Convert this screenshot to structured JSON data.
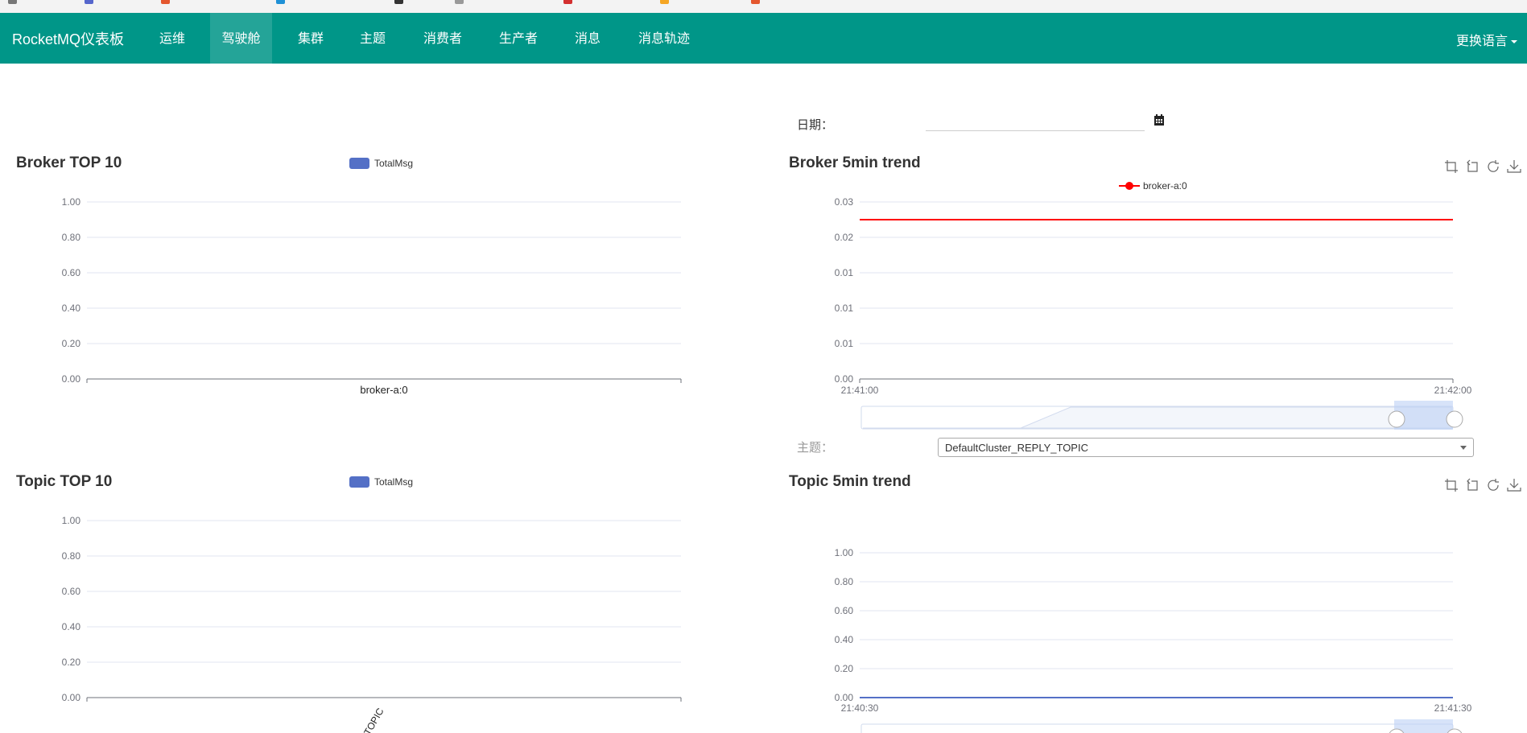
{
  "navbar": {
    "brand": "RocketMQ仪表板",
    "items": [
      {
        "label": "运维"
      },
      {
        "label": "驾驶舱"
      },
      {
        "label": "集群"
      },
      {
        "label": "主题"
      },
      {
        "label": "消费者"
      },
      {
        "label": "生产者"
      },
      {
        "label": "消息"
      },
      {
        "label": "消息轨迹"
      }
    ],
    "active_item": "驾驶舱",
    "language": "更换语言"
  },
  "date_filter": {
    "label": "日期：",
    "value": ""
  },
  "topic_filter": {
    "label": "主题：",
    "selected": "DefaultCluster_REPLY_TOPIC"
  },
  "colors": {
    "navbar": "#009688",
    "bar_series": "#5470c6",
    "broker_trend_line": "#ff0000",
    "topic_trend_line": "#5470c6"
  },
  "chart_data": [
    {
      "type": "bar",
      "title": "Broker TOP 10",
      "legend": [
        "TotalMsg"
      ],
      "categories": [
        "broker-a:0"
      ],
      "series": [
        {
          "name": "TotalMsg",
          "values": [
            0
          ]
        }
      ],
      "y_ticks": [
        "0.00",
        "0.20",
        "0.40",
        "0.60",
        "0.80",
        "1.00"
      ],
      "ylim": [
        0,
        1
      ],
      "grid": true
    },
    {
      "type": "line",
      "title": "Broker 5min trend",
      "legend": [
        "broker-a:0"
      ],
      "x_ticks": [
        "21:41:00",
        "21:42:00"
      ],
      "y_ticks": [
        "0.00",
        "0.01",
        "0.01",
        "0.01",
        "0.02",
        "0.03"
      ],
      "ylim": [
        0,
        0.025
      ],
      "series": [
        {
          "name": "broker-a:0",
          "x": [
            "21:41:00",
            "21:42:00"
          ],
          "values": [
            0.0225,
            0.0225
          ]
        }
      ],
      "grid": true,
      "has_data_zoom": true
    },
    {
      "type": "bar",
      "title": "Topic TOP 10",
      "legend": [
        "TotalMsg"
      ],
      "categories": [
        "DefaultCluster_REPLY_TOPIC"
      ],
      "category_label_visible": "_TOPIC",
      "series": [
        {
          "name": "TotalMsg",
          "values": [
            0
          ]
        }
      ],
      "y_ticks": [
        "0.00",
        "0.20",
        "0.40",
        "0.60",
        "0.80",
        "1.00"
      ],
      "ylim": [
        0,
        1
      ],
      "grid": true
    },
    {
      "type": "line",
      "title": "Topic 5min trend",
      "x_ticks": [
        "21:40:30",
        "21:41:30"
      ],
      "y_ticks": [
        "0.00",
        "0.20",
        "0.40",
        "0.60",
        "0.80",
        "1.00"
      ],
      "ylim": [
        0,
        1
      ],
      "series": [
        {
          "values": [
            0,
            0
          ]
        }
      ],
      "grid": true,
      "has_data_zoom": true
    }
  ]
}
